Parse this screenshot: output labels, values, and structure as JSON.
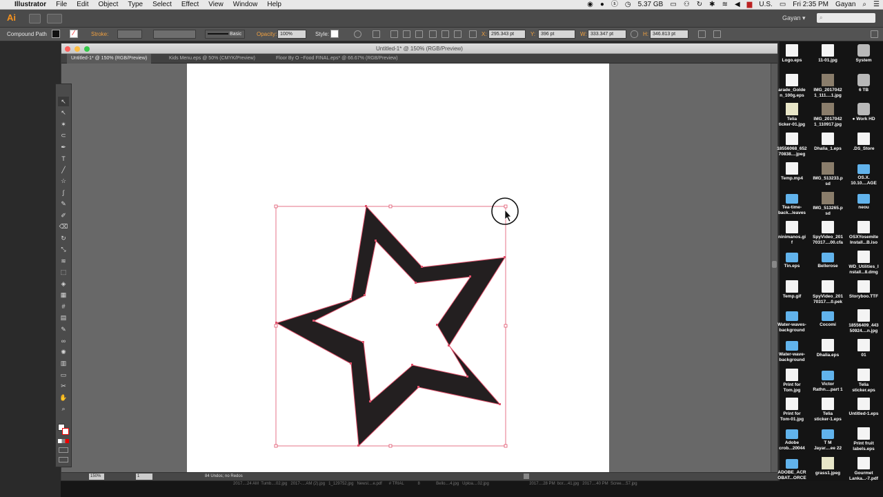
{
  "menubar": {
    "apple": "",
    "app": "Illustrator",
    "items": [
      "File",
      "Edit",
      "Object",
      "Type",
      "Select",
      "Effect",
      "View",
      "Window",
      "Help"
    ],
    "status": {
      "memory": "5.37 GB",
      "locale": "U.S.",
      "time": "Fri 2:35 PM",
      "user": "Gayan"
    }
  },
  "appbar": {
    "logo": "Ai",
    "workspace": "Gayan ▾",
    "search_placeholder": "⌕"
  },
  "control": {
    "object_type": "Compound Path",
    "stroke_label": "Stroke:",
    "brush": "Basic",
    "opacity_label": "Opacity:",
    "opacity": "100%",
    "style_label": "Style:",
    "x_label": "X:",
    "x": "295.343 pt",
    "y_label": "Y:",
    "y": "396 pt",
    "w_label": "W:",
    "w": "333.347 pt",
    "h_label": "H:",
    "h": "346.813 pt"
  },
  "document": {
    "title": "Untitled-1* @ 150% (RGB/Preview)",
    "tabs": [
      {
        "label": "Untitled-1* @ 150% (RGB/Preview)",
        "active": true
      },
      {
        "label": "Kids Menu.eps @ 50% (CMYK/Preview)",
        "active": false
      },
      {
        "label": "Floor By O ~Food FINAL.eps* @ 66.67% (RGB/Preview)",
        "active": false
      }
    ],
    "zoom": "150%",
    "artboard": "1",
    "status": "84 Undos; no Redos"
  },
  "tools": [
    "selection-tool",
    "direct-selection-tool",
    "magic-wand-tool",
    "lasso-tool",
    "pen-tool",
    "type-tool",
    "line-segment-tool",
    "star-tool",
    "paintbrush-tool",
    "pencil-tool",
    "blob-brush-tool",
    "eraser-tool",
    "rotate-tool",
    "scale-tool",
    "width-tool",
    "free-transform-tool",
    "shape-builder-tool",
    "perspective-grid-tool",
    "mesh-tool",
    "gradient-tool",
    "eyedropper-tool",
    "blend-tool",
    "symbol-sprayer-tool",
    "column-graph-tool",
    "artboard-tool",
    "slice-tool",
    "hand-tool",
    "zoom-tool"
  ],
  "desktop_icons": [
    {
      "name": "Logo.eps",
      "kind": "file"
    },
    {
      "name": "11-01.jpg",
      "kind": "file"
    },
    {
      "name": "System",
      "kind": "disk"
    },
    {
      "name": "arade_Golde\nn_100g.eps",
      "kind": "file"
    },
    {
      "name": "IMG_2017042\n1_111....1.jpg",
      "kind": "img"
    },
    {
      "name": "6 TB",
      "kind": "disk"
    },
    {
      "name": "Telia\nticker-01.jpg",
      "kind": "imgl"
    },
    {
      "name": "IMG_2017042\n1_110917.jpg",
      "kind": "img"
    },
    {
      "name": "● Work HD",
      "kind": "disk"
    },
    {
      "name": "18556068_652\n70838....jpeg",
      "kind": "file"
    },
    {
      "name": "Dhalia_1.eps",
      "kind": "file"
    },
    {
      "name": ".DS_Store",
      "kind": "file"
    },
    {
      "name": "Temp.mp4",
      "kind": "file"
    },
    {
      "name": "IMG_513233.p\nsd",
      "kind": "img"
    },
    {
      "name": "OS.X.\n10.10....AGE",
      "kind": "folder"
    },
    {
      "name": "Tea-time-\nback...leaves",
      "kind": "folder"
    },
    {
      "name": "IMG_513265.p\nsd",
      "kind": "img"
    },
    {
      "name": "neou",
      "kind": "folder"
    },
    {
      "name": "ninimanos.gi\nf",
      "kind": "file"
    },
    {
      "name": "SpyVideo_201\n70317....00.cfa",
      "kind": "file"
    },
    {
      "name": "OSXYosemite\nInstall...B.iso",
      "kind": "file"
    },
    {
      "name": "Tin.eps",
      "kind": "folder"
    },
    {
      "name": "Bellerose",
      "kind": "folder"
    },
    {
      "name": "WD_Utilities_I\nnstall...8.dmg",
      "kind": "file"
    },
    {
      "name": "Temp.gif",
      "kind": "file"
    },
    {
      "name": "SpyVideo_201\n70317....0.pek",
      "kind": "file"
    },
    {
      "name": "Storyboo.TTF",
      "kind": "file"
    },
    {
      "name": "Water-waves-\nbackground",
      "kind": "folder"
    },
    {
      "name": "Cocomi",
      "kind": "folder"
    },
    {
      "name": "18556409_443\n50924....n.jpg",
      "kind": "file"
    },
    {
      "name": "Water-wave-\nbackground",
      "kind": "folder"
    },
    {
      "name": "Dhalia.eps",
      "kind": "file"
    },
    {
      "name": "01",
      "kind": "file"
    },
    {
      "name": "Print for\nTom.jpg",
      "kind": "file"
    },
    {
      "name": "Victor\nRathn....part 1",
      "kind": "folder"
    },
    {
      "name": "Telia\nsticker.eps",
      "kind": "file"
    },
    {
      "name": "Print for\nTom-01.jpg",
      "kind": "file"
    },
    {
      "name": "Telia\nsticker-1.eps",
      "kind": "file"
    },
    {
      "name": "Untitled-1.eps",
      "kind": "file"
    },
    {
      "name": "Adobe\ncrob...20044",
      "kind": "folder"
    },
    {
      "name": "T M\nJayar....ee 22",
      "kind": "folder"
    },
    {
      "name": "Print fruit\nlabels.eps",
      "kind": "file"
    },
    {
      "name": "ADOBE_ACR\nOBAT...ORCE",
      "kind": "folder"
    },
    {
      "name": "grass1.jpeg",
      "kind": "imgl"
    },
    {
      "name": "Gourmet\nLanka...-7.pdf",
      "kind": "file"
    }
  ],
  "bottom_strip": "2017....24 AM  Tumb....02.jpg   2017-....AM (2).jpg   1_129752.jpg   Newsl....e.pdf      # TRIAL            8              Bello....4.jpg   Uploa....02.jpg                                   2017....28 PM  bor....41.jpg   2017....40 PM  Scree....57.jpg",
  "colors": {
    "star_fill": "#231f20",
    "selection": "#e0506a",
    "accent_orange": "#f7931e"
  }
}
